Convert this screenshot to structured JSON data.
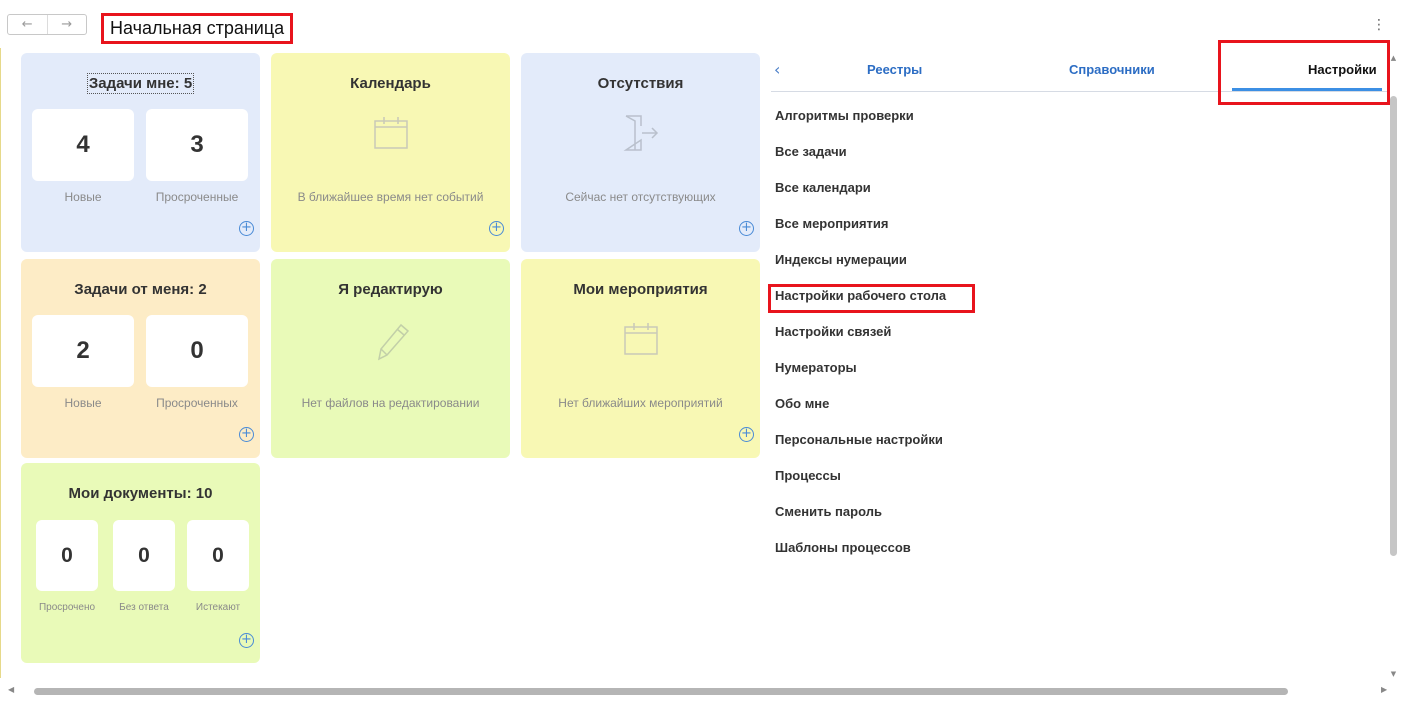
{
  "header": {
    "back_glyph": "←",
    "forward_glyph": "→",
    "title": "Начальная страница",
    "more_glyph": "⋮"
  },
  "tiles": {
    "tasks_to_me": {
      "title": "Задачи мне: 5",
      "counters": [
        {
          "value": "4",
          "label": "Новые"
        },
        {
          "value": "3",
          "label": "Просроченные"
        }
      ]
    },
    "calendar": {
      "title": "Календарь",
      "icon": "calendar-icon",
      "message": "В ближайшее время нет событий"
    },
    "absences": {
      "title": "Отсутствия",
      "icon": "door-exit-icon",
      "message": "Сейчас нет отсутствующих"
    },
    "tasks_from_me": {
      "title": "Задачи от меня: 2",
      "counters": [
        {
          "value": "2",
          "label": "Новые"
        },
        {
          "value": "0",
          "label": "Просроченных"
        }
      ]
    },
    "editing": {
      "title": "Я редактирую",
      "icon": "pencil-icon",
      "message": "Нет файлов на редактировании"
    },
    "my_events": {
      "title": "Мои мероприятия",
      "icon": "calendar-icon",
      "message": "Нет ближайших мероприятий"
    },
    "my_documents": {
      "title": "Мои документы: 10",
      "counters": [
        {
          "value": "0",
          "label": "Просрочено"
        },
        {
          "value": "0",
          "label": "Без ответа"
        },
        {
          "value": "0",
          "label": "Истекают"
        }
      ]
    },
    "add_glyph": "+"
  },
  "panel": {
    "back_glyph": "‹",
    "tabs": [
      {
        "label": "Реестры"
      },
      {
        "label": "Справочники"
      },
      {
        "label": "Настройки"
      }
    ],
    "active_tab": "Настройки",
    "items": [
      "Алгоритмы проверки",
      "Все задачи",
      "Все календари",
      "Все мероприятия",
      "Индексы нумерации",
      "Настройки рабочего стола",
      "Настройки связей",
      "Нумераторы",
      "Обо мне",
      "Персональные настройки",
      "Процессы",
      "Сменить пароль",
      "Шаблоны процессов"
    ]
  },
  "colors": {
    "tile_blue": "#e3ebfa",
    "tile_yellow": "#f8f8b4",
    "tile_orange": "#fdecc6",
    "tile_green": "#e9fab8",
    "link_blue": "#2c6dc4",
    "highlight_red": "#e8141d"
  }
}
